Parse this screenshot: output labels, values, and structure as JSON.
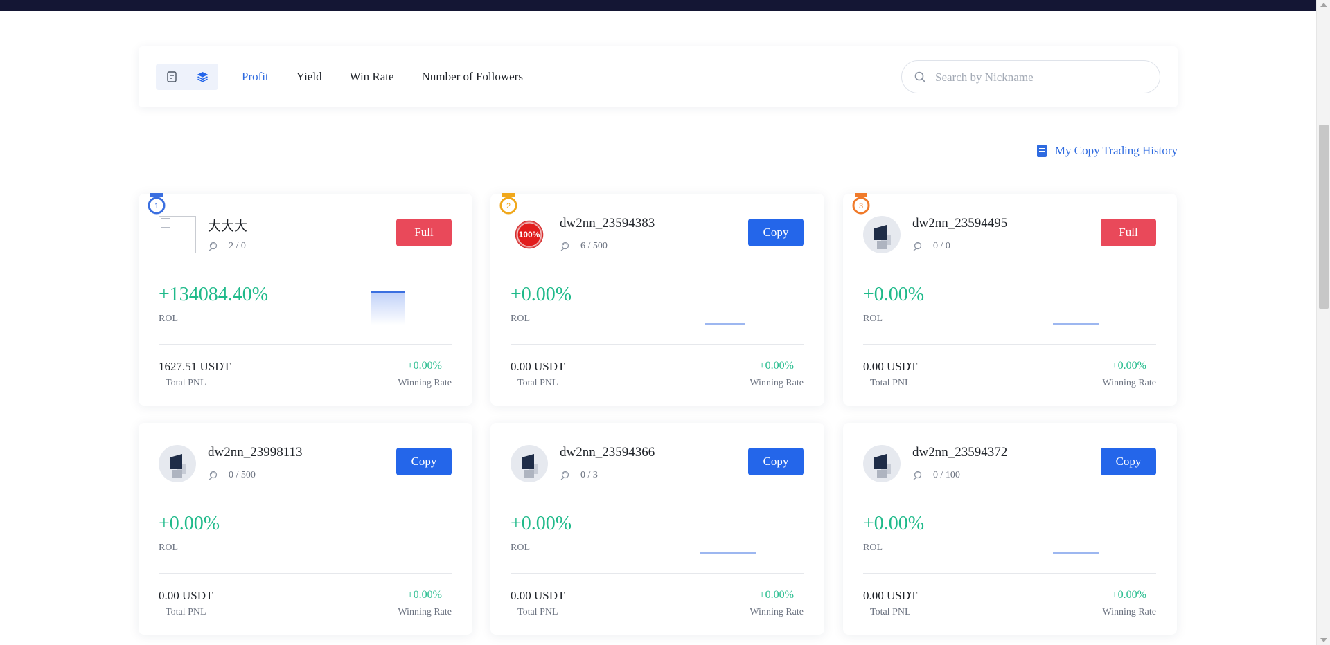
{
  "sort_tabs": [
    "Profit",
    "Yield",
    "Win Rate",
    "Number of Followers"
  ],
  "active_sort": "Profit",
  "search": {
    "placeholder": "Search by Nickname",
    "value": ""
  },
  "history_link": "My Copy Trading History",
  "labels": {
    "rol": "ROL",
    "total_pnl": "Total PNL",
    "winning_rate": "Winning Rate"
  },
  "colors": {
    "accent": "#2f6be0",
    "positive": "#1fba8a",
    "full_button": "#e9495a",
    "copy_button": "#2466ea",
    "header": "#141634"
  },
  "traders": [
    {
      "rank": "1",
      "nickname": "大大大",
      "followers": "2 / 0",
      "button": "Full",
      "rol": "+134084.40%",
      "total_pnl": "1627.51 USDT",
      "winning_rate": "+0.00%",
      "avatar": "broken-image"
    },
    {
      "rank": "2",
      "nickname": "dw2nn_23594383",
      "followers": "6 / 500",
      "button": "Copy",
      "rol": "+0.00%",
      "total_pnl": "0.00 USDT",
      "winning_rate": "+0.00%",
      "avatar": "stamp-100-percent",
      "avatar_text": "100%"
    },
    {
      "rank": "3",
      "nickname": "dw2nn_23594495",
      "followers": "0 / 0",
      "button": "Full",
      "rol": "+0.00%",
      "total_pnl": "0.00 USDT",
      "winning_rate": "+0.00%",
      "avatar": "default-avatar"
    },
    {
      "rank": "",
      "nickname": "dw2nn_23998113",
      "followers": "0 / 500",
      "button": "Copy",
      "rol": "+0.00%",
      "total_pnl": "0.00 USDT",
      "winning_rate": "+0.00%",
      "avatar": "default-avatar"
    },
    {
      "rank": "",
      "nickname": "dw2nn_23594366",
      "followers": "0 / 3",
      "button": "Copy",
      "rol": "+0.00%",
      "total_pnl": "0.00 USDT",
      "winning_rate": "+0.00%",
      "avatar": "default-avatar"
    },
    {
      "rank": "",
      "nickname": "dw2nn_23594372",
      "followers": "0 / 100",
      "button": "Copy",
      "rol": "+0.00%",
      "total_pnl": "0.00 USDT",
      "winning_rate": "+0.00%",
      "avatar": "default-avatar"
    }
  ]
}
